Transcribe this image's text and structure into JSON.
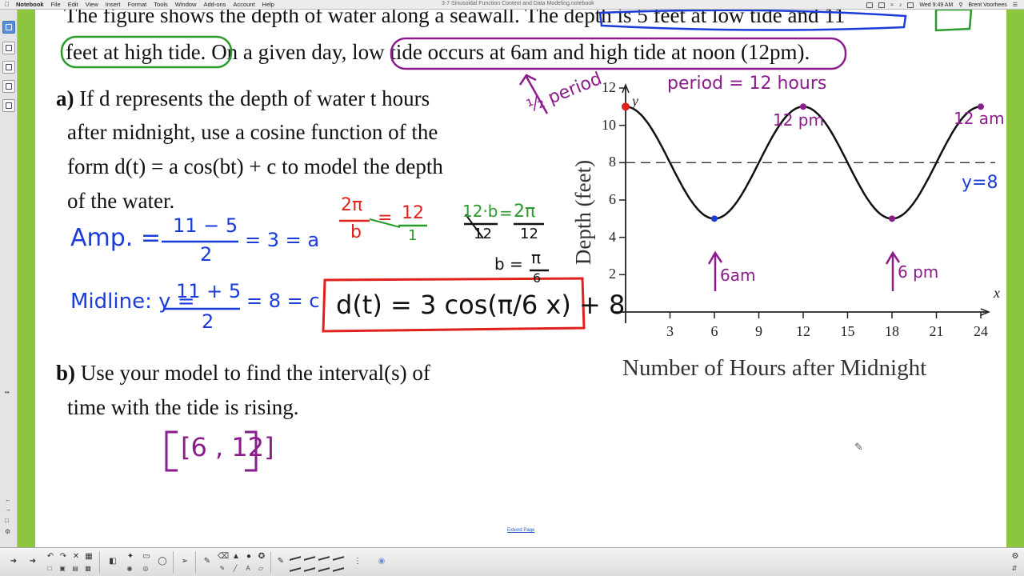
{
  "menubar": {
    "app": "Notebook",
    "menus": [
      "File",
      "Edit",
      "View",
      "Insert",
      "Format",
      "Tools",
      "Window",
      "Add-ons",
      "Account",
      "Help"
    ],
    "document_title": "3-7 Sinusoidal Function Context and Data Modeling.notebook",
    "clock": "Wed 9:49 AM",
    "user": "Brent Voorhees"
  },
  "page": {
    "intro_line1": "The figure shows the depth of water along a seawall. The depth is 5 feet at low tide and 11",
    "intro_line2_a": "feet at high tide.",
    "intro_line2_b": " On a given day,",
    "intro_line2_c": "low tide occurs at 6am and high tide at noon",
    "intro_line2_d": " (12pm).",
    "part_a_label": "a)",
    "part_a_l1": " If d represents the depth of water t hours",
    "part_a_l2": "after midnight, use a cosine function of the",
    "part_a_l3": "form d(t) = a cos(bt) + c to model the depth",
    "part_a_l4": "of the water.",
    "part_b_label": "b)",
    "part_b_l1": " Use your model to find the interval(s) of",
    "part_b_l2": "time with the tide is rising.",
    "extend_link": "Extend Page"
  },
  "ink": {
    "amp_label": "Amp. =",
    "amp_num": "11 − 5",
    "amp_den": "2",
    "amp_result": "= 3 = a",
    "midline_label": "Midline: y =",
    "mid_num": "11 + 5",
    "mid_den": "2",
    "mid_result": "= 8 = c",
    "period_2pi": "2π",
    "period_b": "b",
    "period_eq": "=",
    "period_12": "12",
    "period_1": "1",
    "eq2_left": "12·b",
    "eq2_left_den": "12",
    "eq2_eq": "=",
    "eq2_right": "2π",
    "eq2_right_den": "12",
    "b_result": "b =",
    "b_num": "π",
    "b_den": "6",
    "final_model": "d(t) = 3 cos(π/6 x) + 8",
    "half_period": "½ period",
    "period_note": "period = 12 hours",
    "note_12pm": "12 pm",
    "note_12am": "12 am",
    "note_6am": "6am",
    "note_6pm": "6 pm",
    "midline_note": "y=8",
    "interval_answer": "[6 , 12]"
  },
  "chart_data": {
    "type": "line",
    "title": "",
    "xlabel": "Number of Hours after Midnight",
    "ylabel": "Depth (feet)",
    "x_axis_letter": "x",
    "y_axis_letter": "y",
    "xlim": [
      0,
      24
    ],
    "ylim": [
      0,
      12
    ],
    "xticks": [
      3,
      6,
      9,
      12,
      15,
      18,
      21,
      24
    ],
    "yticks": [
      2,
      4,
      6,
      8,
      10,
      12
    ],
    "midline": 8,
    "series": [
      {
        "function": "d(t) = 3cos(pi*t/6) + 8",
        "x": [
          0,
          1,
          2,
          3,
          4,
          5,
          6,
          7,
          8,
          9,
          10,
          11,
          12,
          13,
          14,
          15,
          16,
          17,
          18,
          19,
          20,
          21,
          22,
          23,
          24
        ],
        "y": [
          11,
          10.6,
          9.5,
          8,
          6.5,
          5.4,
          5,
          5.4,
          6.5,
          8,
          9.5,
          10.6,
          11,
          10.6,
          9.5,
          8,
          6.5,
          5.4,
          5,
          5.4,
          6.5,
          8,
          9.5,
          10.6,
          11
        ]
      }
    ],
    "marked_points": [
      {
        "x": 0,
        "y": 11,
        "color": "#e0201c"
      },
      {
        "x": 6,
        "y": 5,
        "color": "#1a3cd8"
      },
      {
        "x": 12,
        "y": 11,
        "color": "#8a1c8c"
      },
      {
        "x": 18,
        "y": 5,
        "color": "#8a1c8c"
      },
      {
        "x": 24,
        "y": 11,
        "color": "#8a1c8c"
      }
    ],
    "colors": {
      "curve": "#111111",
      "midline": "#333333"
    }
  },
  "colors": {
    "green_stripe": "#8cc63f",
    "ink_blue": "#1a3cd8",
    "ink_purple": "#8a1c8c",
    "ink_red": "#e0201c",
    "ink_green": "#2a9a2a"
  },
  "toolbar": {
    "icons": [
      "back-arrow-icon",
      "forward-arrow-icon",
      "undo-icon",
      "redo-icon",
      "delete-icon",
      "table-icon",
      "screen-shade-icon",
      "add-ons-icon",
      "document-camera-icon",
      "select-icon",
      "pen-icon",
      "shapes-icon",
      "fill-icon",
      "eraser-icon",
      "line-icon",
      "text-icon",
      "highlighter-icon",
      "properties-icon"
    ]
  }
}
